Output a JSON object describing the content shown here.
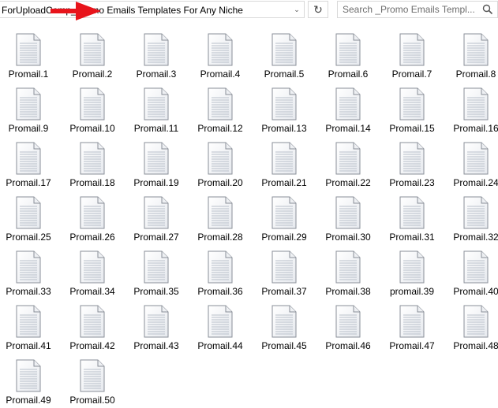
{
  "address_bar": {
    "path_prefix": "ForUploadComp",
    "path_suffix": "_Promo Emails Templates For Any Niche",
    "dropdown_glyph": "⌄"
  },
  "refresh_button": {
    "glyph": "↻"
  },
  "search": {
    "placeholder": "Search _Promo Emails Templ..."
  },
  "annotation": {
    "arrow_color": "#e8141b"
  },
  "files": [
    "Promail.1",
    "Promail.2",
    "Promail.3",
    "Promail.4",
    "Promail.5",
    "Promail.6",
    "Promail.7",
    "Promail.8",
    "Promail.9",
    "Promail.10",
    "Promail.11",
    "Promail.12",
    "Promail.13",
    "Promail.14",
    "Promail.15",
    "Promail.16",
    "Promail.17",
    "Promail.18",
    "Promail.19",
    "Promail.20",
    "Promail.21",
    "Promail.22",
    "Promail.23",
    "Promail.24",
    "Promail.25",
    "Promail.26",
    "Promail.27",
    "Promail.28",
    "Promail.29",
    "Promail.30",
    "Promail.31",
    "Promail.32",
    "Promail.33",
    "Promail.34",
    "Promail.35",
    "Promail.36",
    "Promail.37",
    "Promail.38",
    "promail.39",
    "Promail.40",
    "Promail.41",
    "Promail.42",
    "Promail.43",
    "Promail.44",
    "Promail.45",
    "Promail.46",
    "Promail.47",
    "Promail.48",
    "Promail.49",
    "Promail.50"
  ],
  "file_icon": "text-document-icon"
}
